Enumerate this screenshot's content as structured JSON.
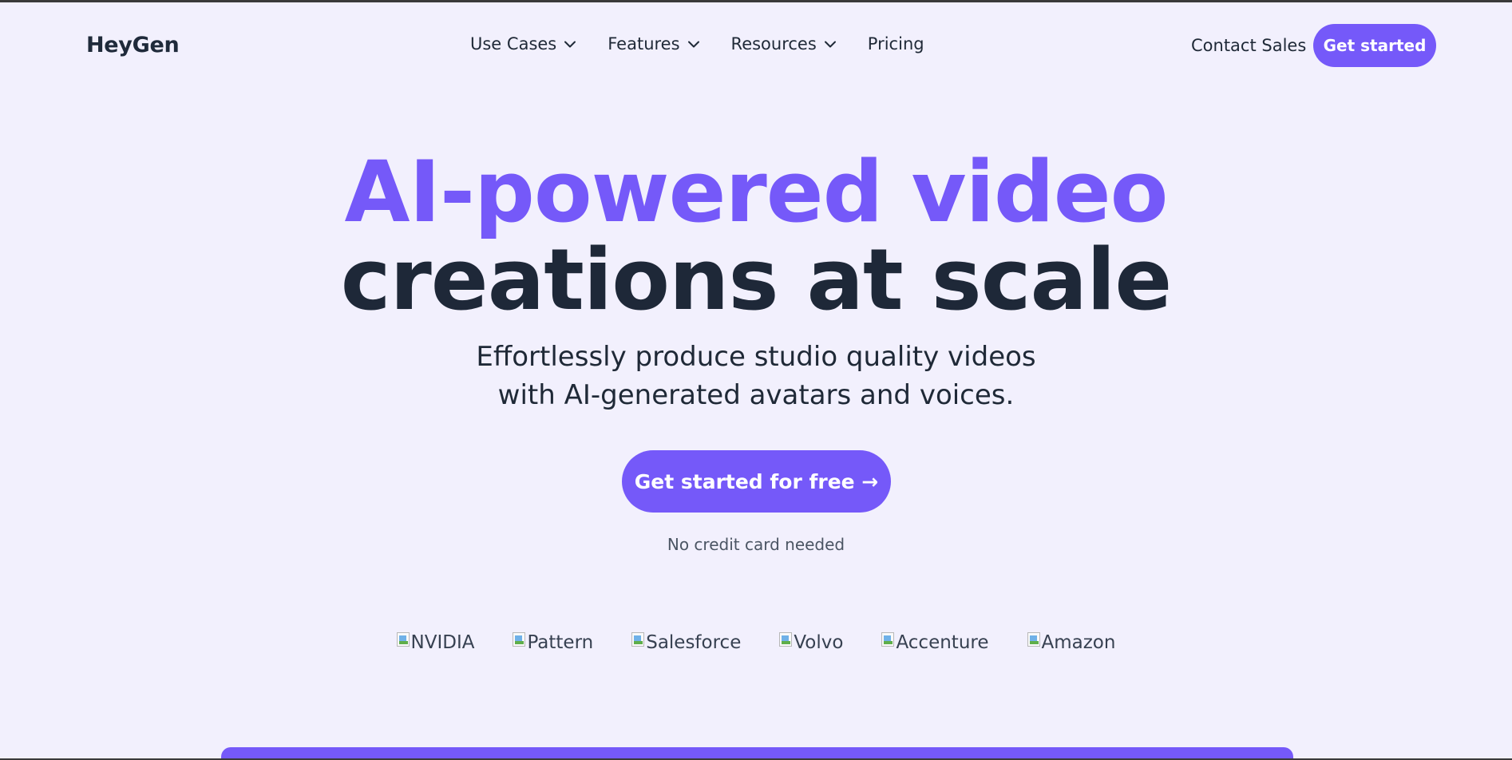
{
  "header": {
    "logo": "HeyGen",
    "nav": [
      {
        "label": "Use Cases",
        "dropdown": true
      },
      {
        "label": "Features",
        "dropdown": true
      },
      {
        "label": "Resources",
        "dropdown": true
      },
      {
        "label": "Pricing",
        "dropdown": false
      }
    ],
    "contact_label": "Contact Sales",
    "get_started_label": "Get started"
  },
  "hero": {
    "title_line1": "AI-powered video",
    "title_line2": "creations at scale",
    "subtitle_line1": "Effortlessly produce studio quality videos",
    "subtitle_line2": "with AI-generated avatars and voices.",
    "cta_label": "Get started for free →",
    "note": "No credit card needed"
  },
  "logos": [
    {
      "alt": "NVIDIA"
    },
    {
      "alt": "Pattern"
    },
    {
      "alt": "Salesforce"
    },
    {
      "alt": "Volvo"
    },
    {
      "alt": "Accenture"
    },
    {
      "alt": "Amazon"
    }
  ],
  "colors": {
    "accent": "#7559f9",
    "background": "#f2f0fd",
    "text_dark": "#1e2838"
  }
}
